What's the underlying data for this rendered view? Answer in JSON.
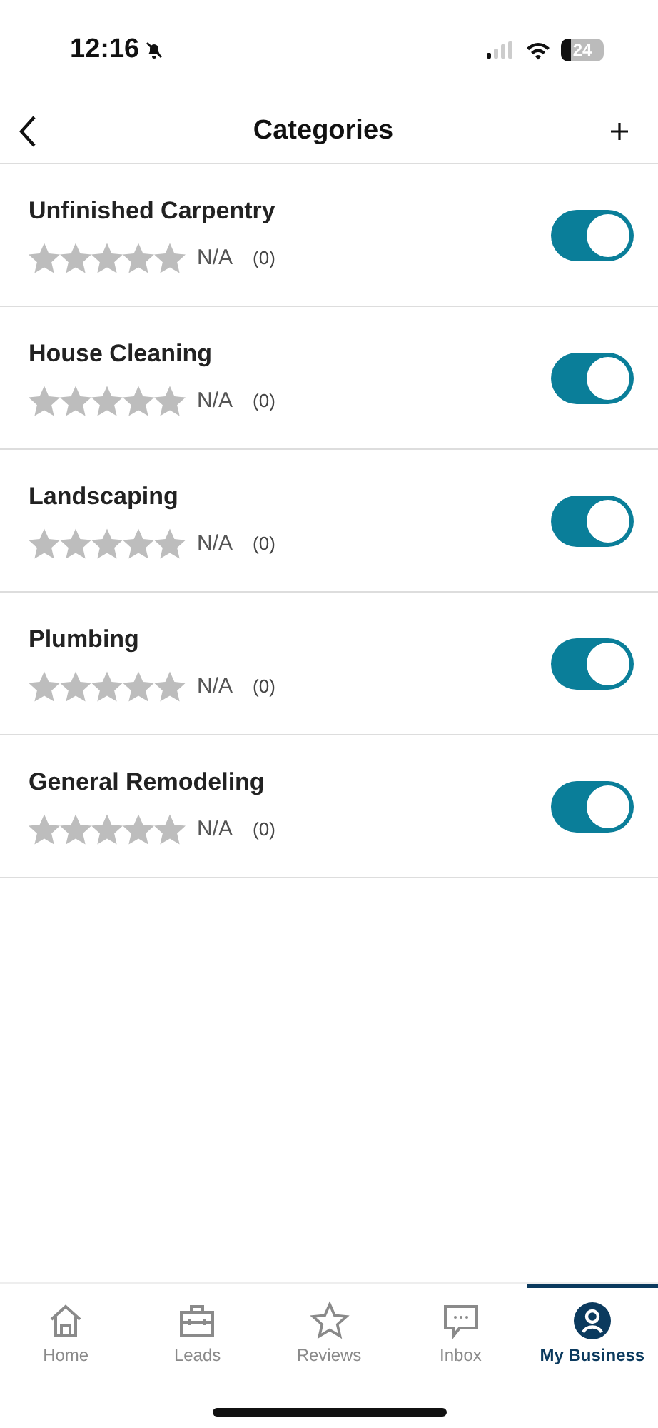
{
  "status_bar": {
    "time": "12:16",
    "battery": "24"
  },
  "nav": {
    "title": "Categories"
  },
  "categories": [
    {
      "name": "Unfinished Carpentry",
      "stars": 0,
      "rating": "N/A",
      "count": "(0)",
      "on": true
    },
    {
      "name": "House Cleaning",
      "stars": 0,
      "rating": "N/A",
      "count": "(0)",
      "on": true
    },
    {
      "name": "Landscaping",
      "stars": 0,
      "rating": "N/A",
      "count": "(0)",
      "on": true
    },
    {
      "name": "Plumbing",
      "stars": 0,
      "rating": "N/A",
      "count": "(0)",
      "on": true
    },
    {
      "name": "General Remodeling",
      "stars": 0,
      "rating": "N/A",
      "count": "(0)",
      "on": true
    }
  ],
  "tab_bar": [
    {
      "kind": "home",
      "label": "Home",
      "selected": false
    },
    {
      "kind": "leads",
      "label": "Leads",
      "selected": false
    },
    {
      "kind": "reviews",
      "label": "Reviews",
      "selected": false
    },
    {
      "kind": "inbox",
      "label": "Inbox",
      "selected": false
    },
    {
      "kind": "business",
      "label": "My Business",
      "selected": true
    }
  ]
}
